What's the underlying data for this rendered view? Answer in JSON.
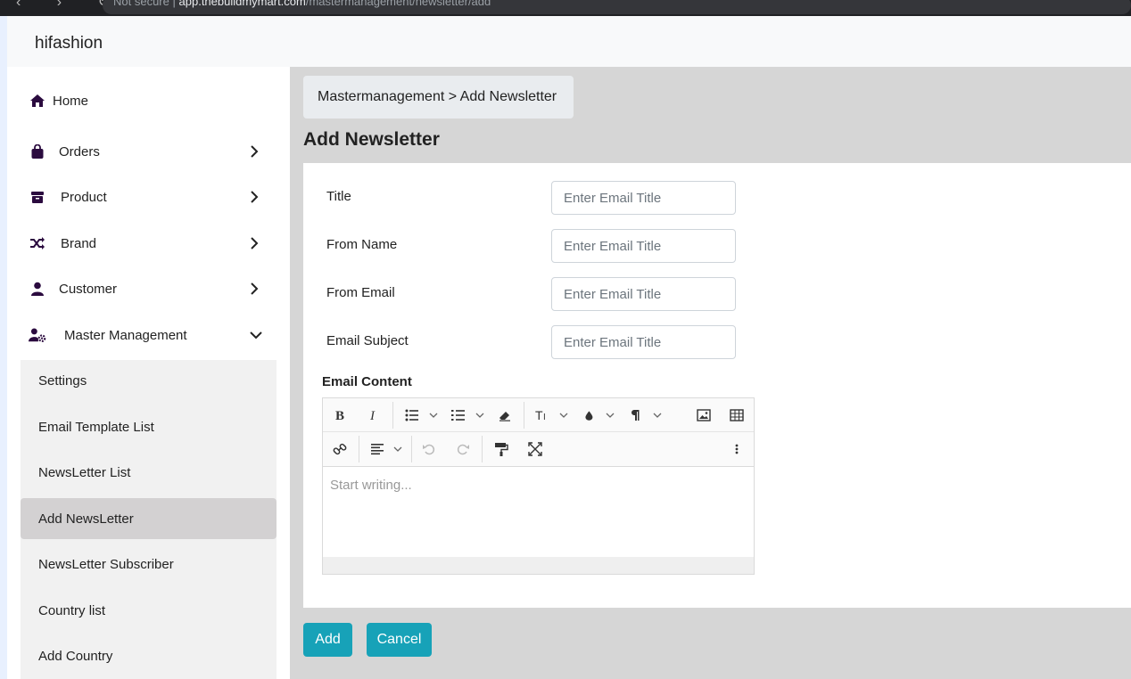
{
  "browser": {
    "nav_glyphs": "‹ › ↻",
    "security": "Not secure",
    "separator": "|",
    "host": "app.thebuildmymart.com",
    "path": "/mastermanagement/newsletter/add"
  },
  "header": {
    "brand": "hifashion"
  },
  "sidebar": {
    "items": [
      {
        "label": "Home",
        "icon": "home-icon"
      },
      {
        "label": "Orders",
        "icon": "shopping-bag-icon"
      },
      {
        "label": "Product",
        "icon": "archive-box-icon"
      },
      {
        "label": "Brand",
        "icon": "shuffle-icon"
      },
      {
        "label": "Customer",
        "icon": "user-icon"
      },
      {
        "label": "Master Management",
        "icon": "user-cog-icon"
      }
    ],
    "submenu": [
      {
        "label": "Settings"
      },
      {
        "label": "Email Template List"
      },
      {
        "label": "NewsLetter List"
      },
      {
        "label": "Add NewsLetter",
        "active": true
      },
      {
        "label": "NewsLetter Subscriber"
      },
      {
        "label": "Country list"
      },
      {
        "label": "Add Country"
      }
    ]
  },
  "breadcrumb": "Mastermanagement > Add Newsletter",
  "page_title": "Add Newsletter",
  "form": {
    "fields": [
      {
        "label": "Title",
        "placeholder": "Enter Email Title",
        "value": ""
      },
      {
        "label": "From Name",
        "placeholder": "Enter Email Title",
        "value": ""
      },
      {
        "label": "From Email",
        "placeholder": "Enter Email Title",
        "value": ""
      },
      {
        "label": "Email Subject",
        "placeholder": "Enter Email Title",
        "value": ""
      }
    ],
    "content_label": "Email Content",
    "editor_placeholder": "Start writing...",
    "toolbar": [
      "bold",
      "italic",
      "bullet-list",
      "numbered-list",
      "eraser",
      "font-size",
      "font-color",
      "paragraph",
      "image",
      "table",
      "link",
      "align",
      "undo",
      "redo",
      "format-painter",
      "fullscreen",
      "more"
    ]
  },
  "buttons": {
    "add": "Add",
    "cancel": "Cancel"
  },
  "colors": {
    "accent": "#17a2b8",
    "active_item": "#d3d1d2",
    "icon": "#2b0b3f"
  }
}
